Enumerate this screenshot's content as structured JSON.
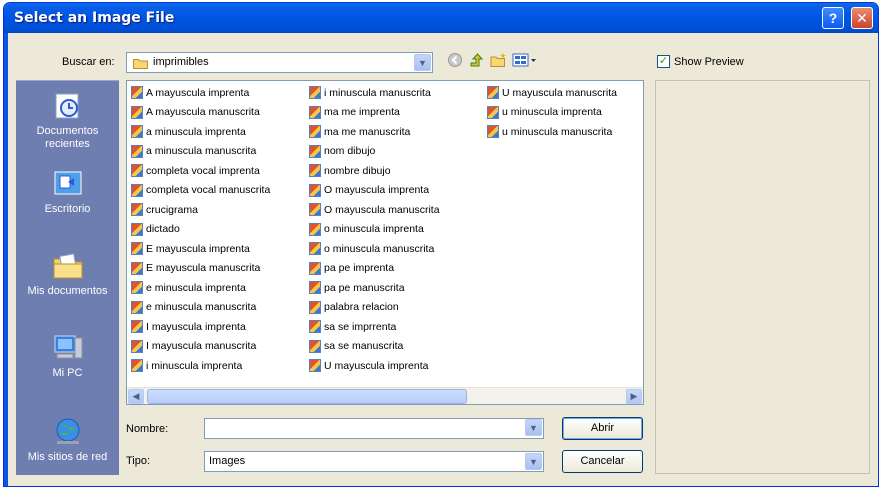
{
  "window": {
    "title": "Select an Image File",
    "help_label": "?",
    "close_label": "✕"
  },
  "lookin": {
    "label": "Buscar en:",
    "value": "imprimibles"
  },
  "preview": {
    "label": "Show Preview",
    "checked": true
  },
  "places": [
    {
      "label": "Documentos recientes",
      "icon": "recent-documents-icon"
    },
    {
      "label": "Escritorio",
      "icon": "desktop-icon"
    },
    {
      "label": "Mis documentos",
      "icon": "my-documents-icon"
    },
    {
      "label": "Mi PC",
      "icon": "my-computer-icon"
    },
    {
      "label": "Mis sitios de red",
      "icon": "network-places-icon"
    }
  ],
  "files": {
    "col1": [
      "A mayuscula imprenta",
      "A mayuscula manuscrita",
      "a minuscula imprenta",
      "a minuscula manuscrita",
      "completa vocal imprenta",
      "completa vocal manuscrita",
      "crucigrama",
      "dictado",
      "E mayuscula imprenta",
      "E mayuscula manuscrita",
      "e minuscula imprenta",
      "e minuscula manuscrita",
      "I mayuscula imprenta",
      "I mayuscula manuscrita",
      "i minuscula imprenta"
    ],
    "col2": [
      "i minuscula manuscrita",
      "ma me imprenta",
      "ma me manuscrita",
      "nom dibujo",
      "nombre dibujo",
      "O mayuscula imprenta",
      "O mayuscula manuscrita",
      "o minuscula imprenta",
      "o minuscula manuscrita",
      "pa pe imprenta",
      "pa pe manuscrita",
      "palabra relacion",
      "sa se imprrenta",
      "sa se manuscrita",
      "U mayuscula imprenta"
    ],
    "col3": [
      "U mayuscula manuscrita",
      "u minuscula imprenta",
      "u minuscula manuscrita"
    ]
  },
  "filename": {
    "label": "Nombre:",
    "value": ""
  },
  "filetype": {
    "label": "Tipo:",
    "value": "Images"
  },
  "buttons": {
    "open": "Abrir",
    "cancel": "Cancelar"
  }
}
